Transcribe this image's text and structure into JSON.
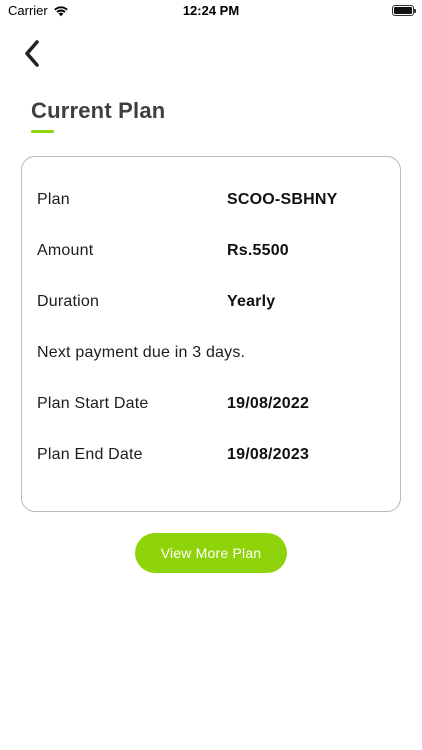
{
  "status_bar": {
    "carrier": "Carrier",
    "time": "12:24 PM",
    "wifi_icon": "wifi-icon",
    "battery_icon": "battery-icon"
  },
  "nav": {
    "back_icon": "chevron-left-icon"
  },
  "page": {
    "title": "Current Plan",
    "accent_color": "#8fd40a"
  },
  "plan": {
    "rows": [
      {
        "label": "Plan",
        "value": "SCOO-SBHNY"
      },
      {
        "label": "Amount",
        "value": "Rs.5500"
      },
      {
        "label": "Duration",
        "value": "Yearly"
      },
      {
        "label": "Plan Start Date",
        "value": "19/08/2022"
      },
      {
        "label": "Plan End Date",
        "value": "19/08/2023"
      }
    ],
    "next_payment_note": "Next payment due in 3 days."
  },
  "actions": {
    "view_more_label": "View More Plan"
  }
}
